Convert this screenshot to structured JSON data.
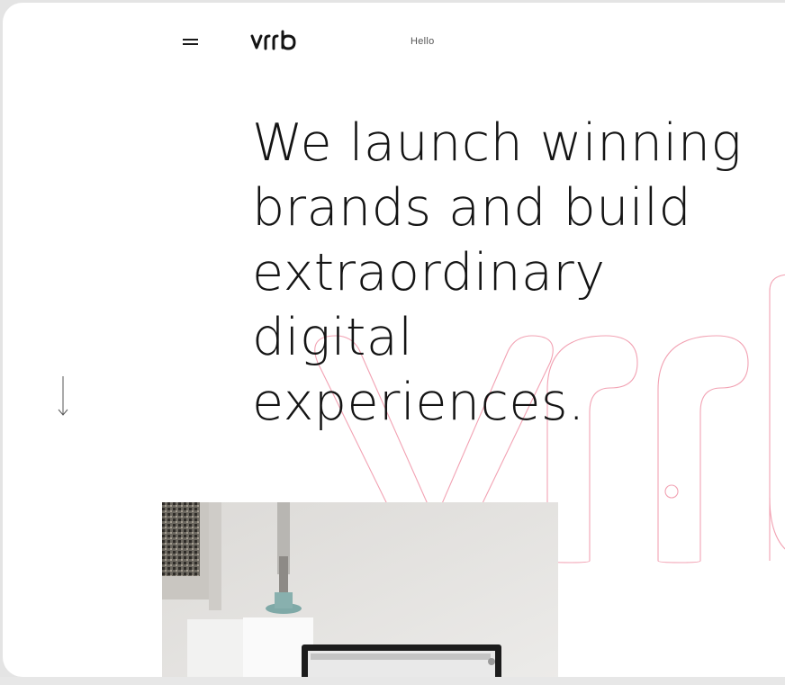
{
  "header": {
    "menu_icon": "hamburger-icon",
    "logo_text": "vrrb",
    "nav_link": "Hello"
  },
  "hero": {
    "headline_lines": [
      "We launch winning",
      "brands and build",
      "extraordinary",
      "digital",
      "experiences."
    ],
    "scroll_icon": "arrow-down-icon",
    "watermark_text": "vrrb"
  },
  "colors": {
    "text": "#141414",
    "accent_outline": "#f08aa0",
    "background": "#ffffff"
  }
}
